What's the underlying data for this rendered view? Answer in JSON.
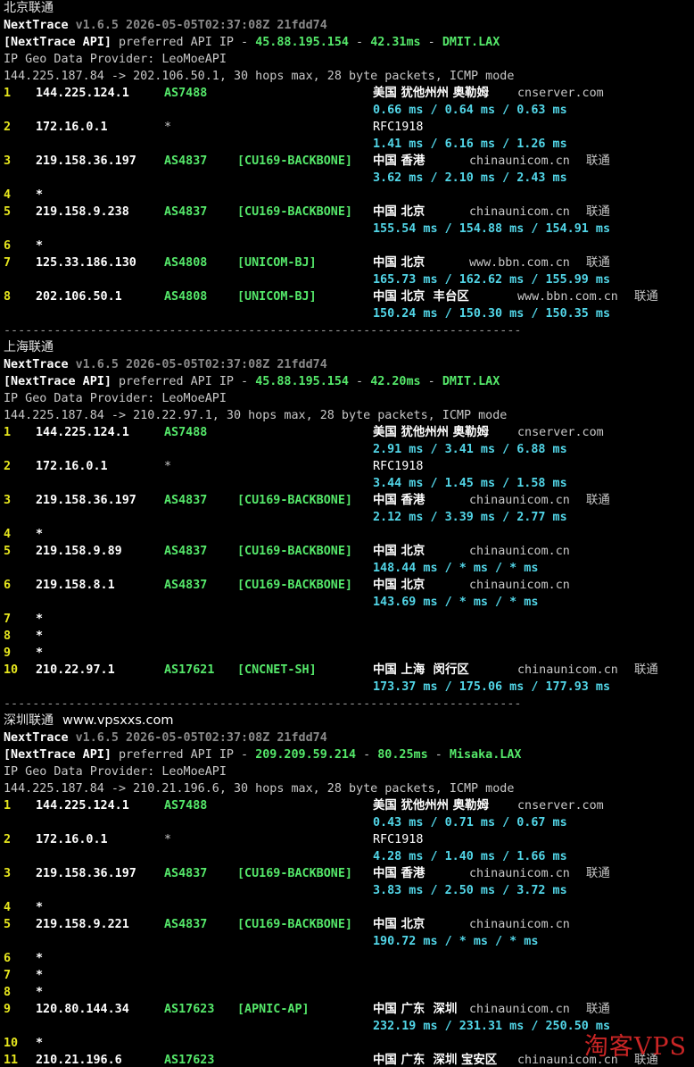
{
  "sections": [
    {
      "title": "北京联通",
      "site": "",
      "version": {
        "name": "NextTrace",
        "info": "v1.6.5 2026-05-05T02:37:08Z 21fdd74"
      },
      "api": {
        "prefix": "[NextTrace API]",
        "text": " preferred API IP - ",
        "ip": "45.88.195.154",
        "dash1": " - ",
        "latency": "42.31ms",
        "dash2": " - ",
        "node": "DMIT.LAX"
      },
      "geo_provider": "IP Geo Data Provider: LeoMoeAPI",
      "route": "144.225.187.84 -> 202.106.50.1, 30 hops max, 28 byte packets, ICMP mode",
      "hops": [
        {
          "num": "1",
          "ip": "144.225.124.1",
          "asn": "AS7488",
          "tag": "",
          "geo": "美国 犹他州州 奥勒姆",
          "domain": "cnserver.com",
          "isp": "",
          "rtt": "0.66 ms / 0.64 ms / 0.63 ms"
        },
        {
          "num": "2",
          "ip": "172.16.0.1",
          "asn": "*",
          "tag": "",
          "geo": "RFC1918",
          "domain": "",
          "isp": "",
          "rtt": "1.41 ms / 6.16 ms / 1.26 ms"
        },
        {
          "num": "3",
          "ip": "219.158.36.197",
          "asn": "AS4837",
          "tag": "[CU169-BACKBONE]",
          "geo": "中国 香港",
          "domain": "chinaunicom.cn",
          "isp": "联通",
          "rtt": "3.62 ms / 2.10 ms / 2.43 ms"
        },
        {
          "num": "4",
          "ip": "*",
          "asn": "",
          "tag": "",
          "geo": "",
          "domain": "",
          "isp": "",
          "rtt": ""
        },
        {
          "num": "5",
          "ip": "219.158.9.238",
          "asn": "AS4837",
          "tag": "[CU169-BACKBONE]",
          "geo": "中国 北京",
          "domain": "chinaunicom.cn",
          "isp": "联通",
          "rtt": "155.54 ms / 154.88 ms / 154.91 ms"
        },
        {
          "num": "6",
          "ip": "*",
          "asn": "",
          "tag": "",
          "geo": "",
          "domain": "",
          "isp": "",
          "rtt": ""
        },
        {
          "num": "7",
          "ip": "125.33.186.130",
          "asn": "AS4808",
          "tag": "[UNICOM-BJ]",
          "geo": "中国 北京",
          "domain": "www.bbn.com.cn",
          "isp": "联通",
          "rtt": "165.73 ms / 162.62 ms / 155.99 ms"
        },
        {
          "num": "8",
          "ip": "202.106.50.1",
          "asn": "AS4808",
          "tag": "[UNICOM-BJ]",
          "geo": "中国 北京  丰台区",
          "domain": "www.bbn.com.cn",
          "isp": "联通",
          "rtt": "150.24 ms / 150.30 ms / 150.35 ms"
        }
      ]
    },
    {
      "title": "上海联通",
      "site": "",
      "version": {
        "name": "NextTrace",
        "info": "v1.6.5 2026-05-05T02:37:08Z 21fdd74"
      },
      "api": {
        "prefix": "[NextTrace API]",
        "text": " preferred API IP - ",
        "ip": "45.88.195.154",
        "dash1": " - ",
        "latency": "42.20ms",
        "dash2": " - ",
        "node": "DMIT.LAX"
      },
      "geo_provider": "IP Geo Data Provider: LeoMoeAPI",
      "route": "144.225.187.84 -> 210.22.97.1, 30 hops max, 28 byte packets, ICMP mode",
      "hops": [
        {
          "num": "1",
          "ip": "144.225.124.1",
          "asn": "AS7488",
          "tag": "",
          "geo": "美国 犹他州州 奥勒姆",
          "domain": "cnserver.com",
          "isp": "",
          "rtt": "2.91 ms / 3.41 ms / 6.88 ms"
        },
        {
          "num": "2",
          "ip": "172.16.0.1",
          "asn": "*",
          "tag": "",
          "geo": "RFC1918",
          "domain": "",
          "isp": "",
          "rtt": "3.44 ms / 1.45 ms / 1.58 ms"
        },
        {
          "num": "3",
          "ip": "219.158.36.197",
          "asn": "AS4837",
          "tag": "[CU169-BACKBONE]",
          "geo": "中国 香港",
          "domain": "chinaunicom.cn",
          "isp": "联通",
          "rtt": "2.12 ms / 3.39 ms / 2.77 ms"
        },
        {
          "num": "4",
          "ip": "*",
          "asn": "",
          "tag": "",
          "geo": "",
          "domain": "",
          "isp": "",
          "rtt": ""
        },
        {
          "num": "5",
          "ip": "219.158.9.89",
          "asn": "AS4837",
          "tag": "[CU169-BACKBONE]",
          "geo": "中国 北京",
          "domain": "chinaunicom.cn",
          "isp": "",
          "rtt": "148.44 ms / * ms / * ms"
        },
        {
          "num": "6",
          "ip": "219.158.8.1",
          "asn": "AS4837",
          "tag": "[CU169-BACKBONE]",
          "geo": "中国 北京",
          "domain": "chinaunicom.cn",
          "isp": "",
          "rtt": "143.69 ms / * ms / * ms"
        },
        {
          "num": "7",
          "ip": "*",
          "asn": "",
          "tag": "",
          "geo": "",
          "domain": "",
          "isp": "",
          "rtt": ""
        },
        {
          "num": "8",
          "ip": "*",
          "asn": "",
          "tag": "",
          "geo": "",
          "domain": "",
          "isp": "",
          "rtt": ""
        },
        {
          "num": "9",
          "ip": "*",
          "asn": "",
          "tag": "",
          "geo": "",
          "domain": "",
          "isp": "",
          "rtt": ""
        },
        {
          "num": "10",
          "ip": "210.22.97.1",
          "asn": "AS17621",
          "tag": "[CNCNET-SH]",
          "geo": "中国 上海  闵行区",
          "domain": "chinaunicom.cn",
          "isp": "联通",
          "rtt": "173.37 ms / 175.06 ms / 177.93 ms"
        }
      ]
    },
    {
      "title": "深圳联通",
      "site": "www.vpsxxs.com",
      "version": {
        "name": "NextTrace",
        "info": "v1.6.5 2026-05-05T02:37:08Z 21fdd74"
      },
      "api": {
        "prefix": "[NextTrace API]",
        "text": " preferred API IP - ",
        "ip": "209.209.59.214",
        "dash1": " - ",
        "latency": "80.25ms",
        "dash2": " - ",
        "node": "Misaka.LAX"
      },
      "geo_provider": "IP Geo Data Provider: LeoMoeAPI",
      "route": "144.225.187.84 -> 210.21.196.6, 30 hops max, 28 byte packets, ICMP mode",
      "hops": [
        {
          "num": "1",
          "ip": "144.225.124.1",
          "asn": "AS7488",
          "tag": "",
          "geo": "美国 犹他州州 奥勒姆",
          "domain": "cnserver.com",
          "isp": "",
          "rtt": "0.43 ms / 0.71 ms / 0.67 ms"
        },
        {
          "num": "2",
          "ip": "172.16.0.1",
          "asn": "*",
          "tag": "",
          "geo": "RFC1918",
          "domain": "",
          "isp": "",
          "rtt": "4.28 ms / 1.40 ms / 1.66 ms"
        },
        {
          "num": "3",
          "ip": "219.158.36.197",
          "asn": "AS4837",
          "tag": "[CU169-BACKBONE]",
          "geo": "中国 香港",
          "domain": "chinaunicom.cn",
          "isp": "联通",
          "rtt": "3.83 ms / 2.50 ms / 3.72 ms"
        },
        {
          "num": "4",
          "ip": "*",
          "asn": "",
          "tag": "",
          "geo": "",
          "domain": "",
          "isp": "",
          "rtt": ""
        },
        {
          "num": "5",
          "ip": "219.158.9.221",
          "asn": "AS4837",
          "tag": "[CU169-BACKBONE]",
          "geo": "中国 北京",
          "domain": "chinaunicom.cn",
          "isp": "",
          "rtt": "190.72 ms / * ms / * ms"
        },
        {
          "num": "6",
          "ip": "*",
          "asn": "",
          "tag": "",
          "geo": "",
          "domain": "",
          "isp": "",
          "rtt": ""
        },
        {
          "num": "7",
          "ip": "*",
          "asn": "",
          "tag": "",
          "geo": "",
          "domain": "",
          "isp": "",
          "rtt": ""
        },
        {
          "num": "8",
          "ip": "*",
          "asn": "",
          "tag": "",
          "geo": "",
          "domain": "",
          "isp": "",
          "rtt": ""
        },
        {
          "num": "9",
          "ip": "120.80.144.34",
          "asn": "AS17623",
          "tag": "[APNIC-AP]",
          "geo": "中国 广东  深圳",
          "domain": "chinaunicom.cn",
          "isp": "联通",
          "rtt": "232.19 ms / 231.31 ms / 250.50 ms"
        },
        {
          "num": "10",
          "ip": "*",
          "asn": "",
          "tag": "",
          "geo": "",
          "domain": "",
          "isp": "",
          "rtt": ""
        },
        {
          "num": "11",
          "ip": "210.21.196.6",
          "asn": "AS17623",
          "tag": "",
          "geo": "中国 广东  深圳 宝安区",
          "domain": "chinaunicom.cn",
          "isp": "联通",
          "rtt": ""
        }
      ]
    }
  ],
  "separator": "------------------------------------------------------------------------",
  "watermark": "淘客VPS",
  "colors": {
    "background": "#000000",
    "hop_number": "#e6e61e",
    "asn": "#55e86a",
    "rtt": "#52d6e8",
    "watermark": "#e02a2a"
  }
}
